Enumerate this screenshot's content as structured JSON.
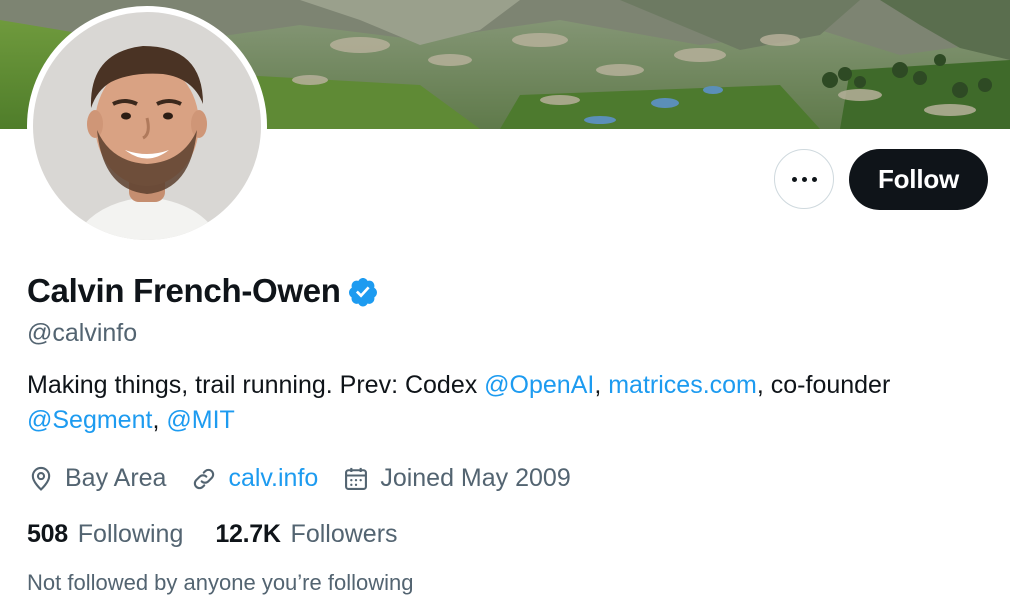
{
  "profile": {
    "display_name": "Calvin French-Owen",
    "handle": "@calvinfo",
    "verified": true,
    "bio": {
      "text_1": "Making things, trail running. Prev: Codex ",
      "mention_openai": "@OpenAI",
      "sep_1": ", ",
      "link_matrices": "matrices.com",
      "text_2": ", co-founder",
      "mention_segment": "@Segment",
      "sep_2": ", ",
      "mention_mit": "@MIT"
    },
    "meta": {
      "location": "Bay Area",
      "website": "calv.info",
      "joined": "Joined May 2009"
    },
    "stats": {
      "following_count": "508",
      "following_label": "Following",
      "followers_count": "12.7K",
      "followers_label": "Followers"
    },
    "mutual_note": "Not followed by anyone you’re following"
  },
  "actions": {
    "follow_label": "Follow",
    "more_icon": "more-horizontal-icon"
  },
  "colors": {
    "primary_text": "#0f1419",
    "secondary_text": "#536471",
    "link": "#1d9bf0",
    "follow_bg": "#0f1419",
    "verified": "#1d9bf0"
  },
  "icons": {
    "location": "location-pin-icon",
    "website": "link-icon",
    "joined": "calendar-icon",
    "verified": "verified-badge-icon"
  }
}
